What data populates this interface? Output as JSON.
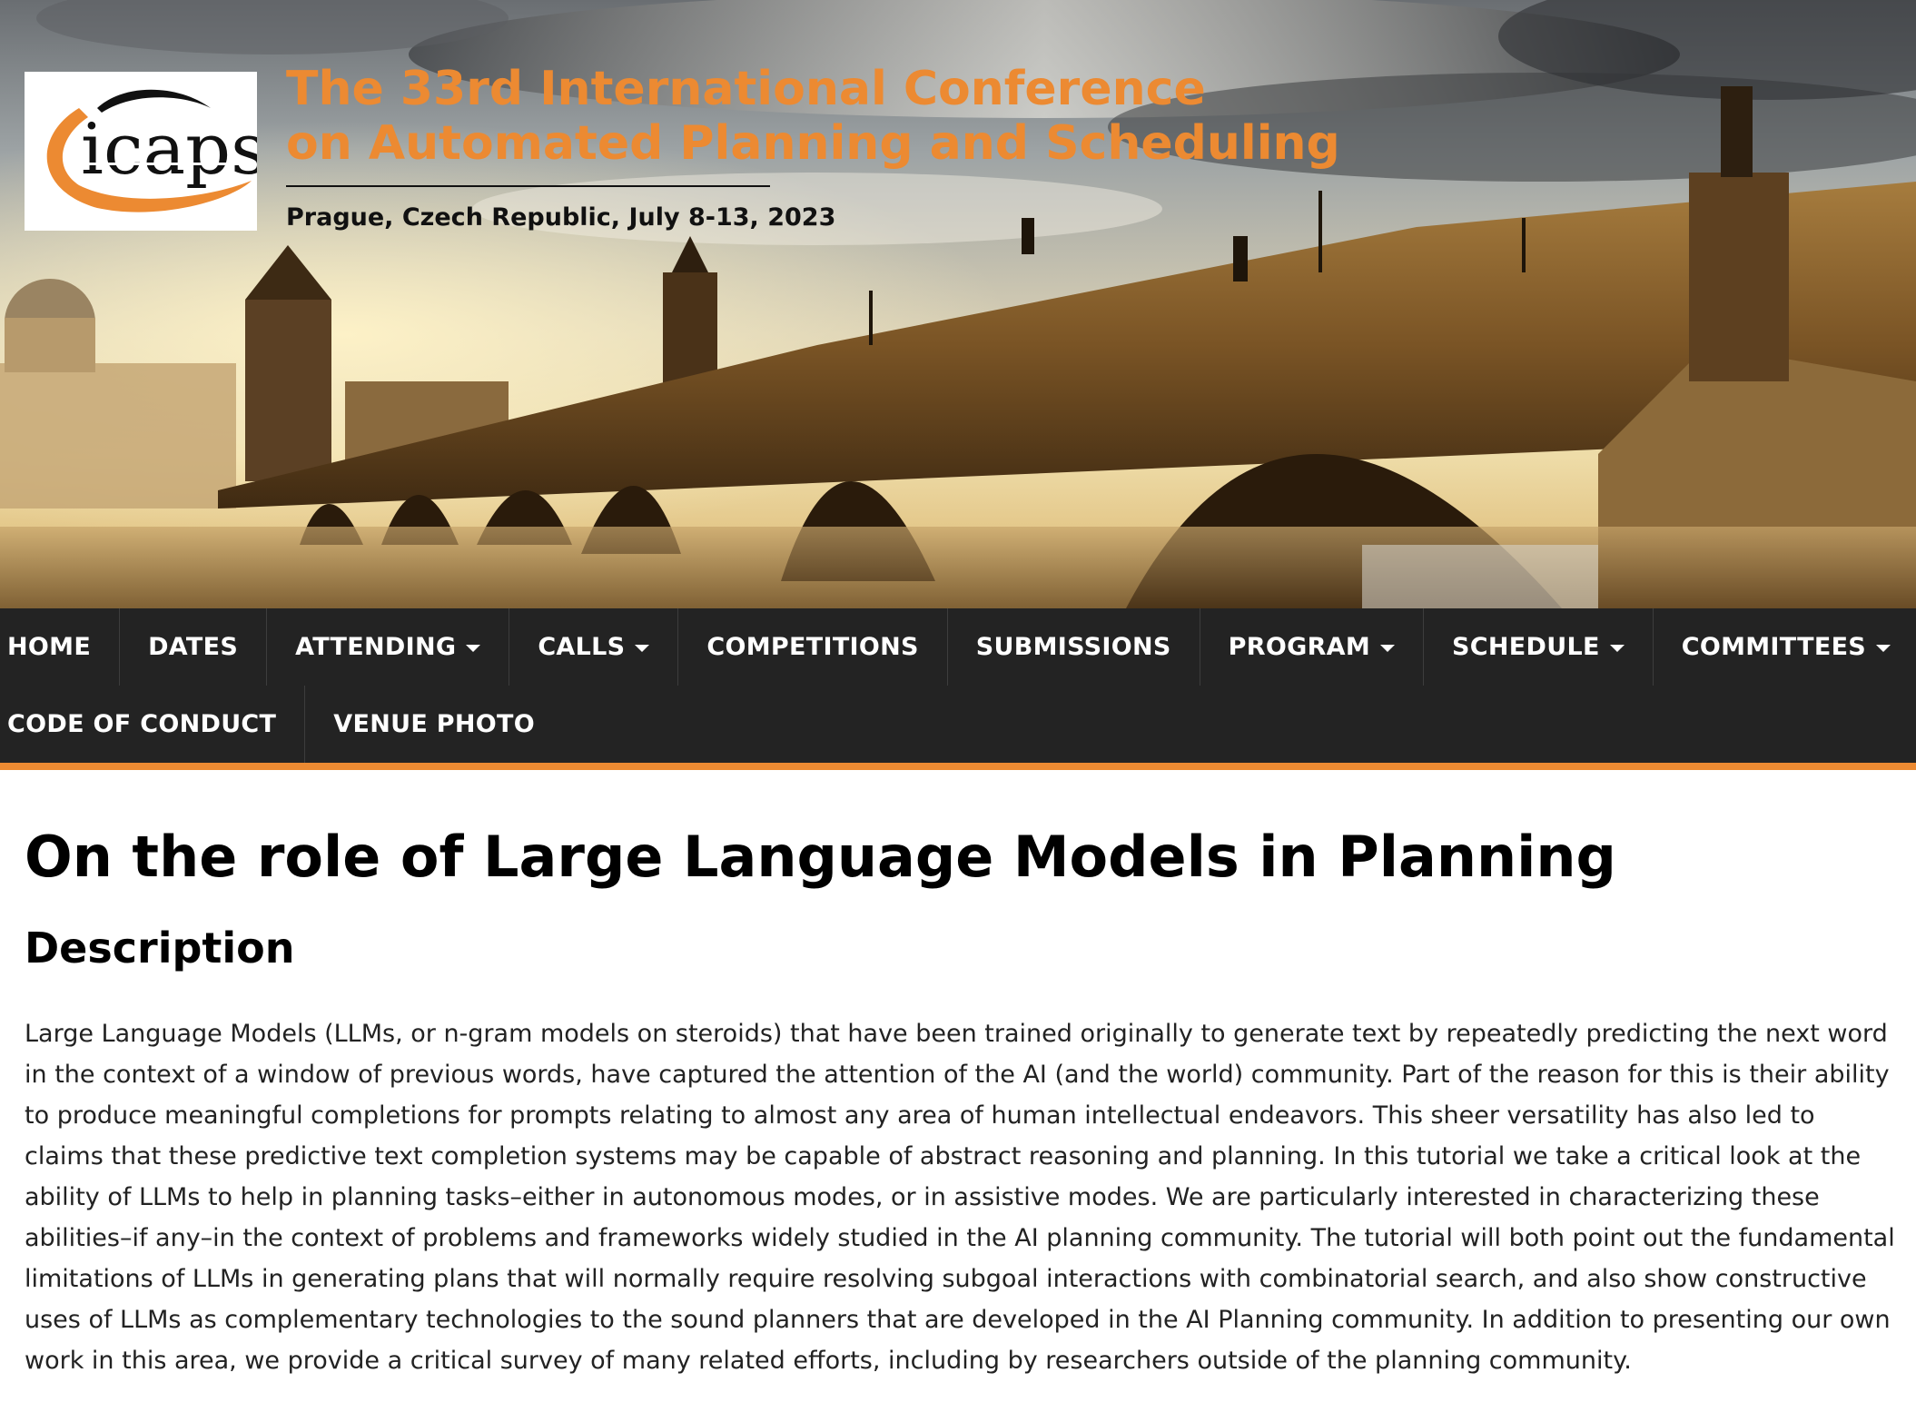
{
  "header": {
    "logo_text": "icaps",
    "title_line1": "The 33rd International Conference",
    "title_line2": "on Automated Planning and Scheduling",
    "subtitle": "Prague, Czech Republic, July 8-13, 2023"
  },
  "nav": {
    "row1": [
      {
        "label": "HOME",
        "dropdown": false
      },
      {
        "label": "DATES",
        "dropdown": false
      },
      {
        "label": "ATTENDING",
        "dropdown": true
      },
      {
        "label": "CALLS",
        "dropdown": true
      },
      {
        "label": "COMPETITIONS",
        "dropdown": false
      },
      {
        "label": "SUBMISSIONS",
        "dropdown": false
      },
      {
        "label": "PROGRAM",
        "dropdown": true
      },
      {
        "label": "SCHEDULE",
        "dropdown": true
      },
      {
        "label": "COMMITTEES",
        "dropdown": true
      }
    ],
    "row2": [
      {
        "label": "CODE OF CONDUCT",
        "dropdown": false
      },
      {
        "label": "VENUE PHOTO",
        "dropdown": false
      }
    ]
  },
  "main": {
    "page_title": "On the role of Large Language Models in Planning",
    "section_title": "Description",
    "description": "Large Language Models (LLMs, or n-gram models on steroids) that have been trained originally to generate text by repeatedly predicting the next word in the context of a window of previous words, have captured the attention of the AI (and the world) community. Part of the reason for this is their ability to produce meaningful completions for prompts relating to almost any area of human intellectual endeavors. This sheer versatility has also led to claims that these predictive text completion systems may be capable of abstract reasoning and planning. In this tutorial we take a critical look at the ability of LLMs to help in planning tasks–either in autonomous modes, or in assistive modes. We are particularly interested in characterizing these abilities–if any–in the context of problems and frameworks widely studied in the AI planning community. The tutorial will both point out the fundamental limitations of LLMs in generating plans that will normally require resolving subgoal interactions with combinatorial search, and also show constructive uses of LLMs as complementary technologies to the sound planners that are developed in the AI Planning community. In addition to presenting our own work in this area, we provide a critical survey of many related efforts, including by researchers outside of the planning community."
  },
  "colors": {
    "accent": "#ec8a32",
    "nav_bg": "#232323",
    "nav_text": "#ffffff",
    "text": "#222222"
  },
  "icons": {
    "dropdown": "caret-down-icon",
    "banner": "charles-bridge-photo"
  }
}
